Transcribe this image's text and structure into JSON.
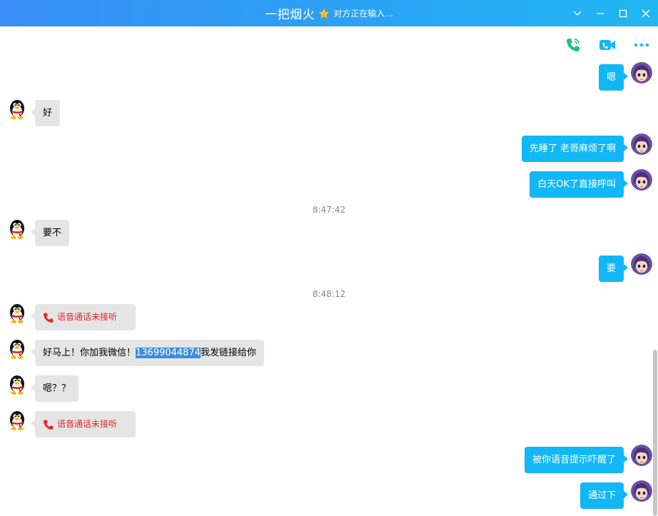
{
  "window": {
    "contact_name": "一把烟火",
    "typing_status": "对方正在输入...",
    "controls": [
      "chevron-down",
      "minimize",
      "maximize",
      "close"
    ]
  },
  "toolbar": {
    "icons": [
      "voice-call-icon",
      "video-call-icon",
      "more-icon"
    ]
  },
  "messages": [
    {
      "side": "out",
      "text": "嗯"
    },
    {
      "side": "in",
      "text": "好"
    },
    {
      "side": "out",
      "text": "先睡了 老哥麻烦了啊"
    },
    {
      "side": "out",
      "text": "白天OK了直接呼叫"
    },
    {
      "timestamp": "8:47:42"
    },
    {
      "side": "in",
      "text": "要不"
    },
    {
      "side": "out",
      "text": "要"
    },
    {
      "timestamp": "8:48:12"
    },
    {
      "side": "in",
      "missed_call": "语音通话未接听"
    },
    {
      "side": "in",
      "text_before": "好马上！你加我微信！",
      "highlight": "13699044874",
      "text_after": "我发链接给你"
    },
    {
      "side": "in",
      "text": "嗯？？"
    },
    {
      "side": "in",
      "missed_call": "语音通话未接听"
    },
    {
      "side": "out",
      "text": "被你语音提示吓醒了"
    },
    {
      "side": "out",
      "text": "通过下"
    }
  ],
  "colors": {
    "accent": "#12b7f5",
    "title_gradient_start": "#3a8ef5",
    "title_gradient_end": "#1fb7f3",
    "missed_call": "#e5262a",
    "incoming_bubble": "#e5e5e5",
    "selection": "#3c8ddb"
  }
}
